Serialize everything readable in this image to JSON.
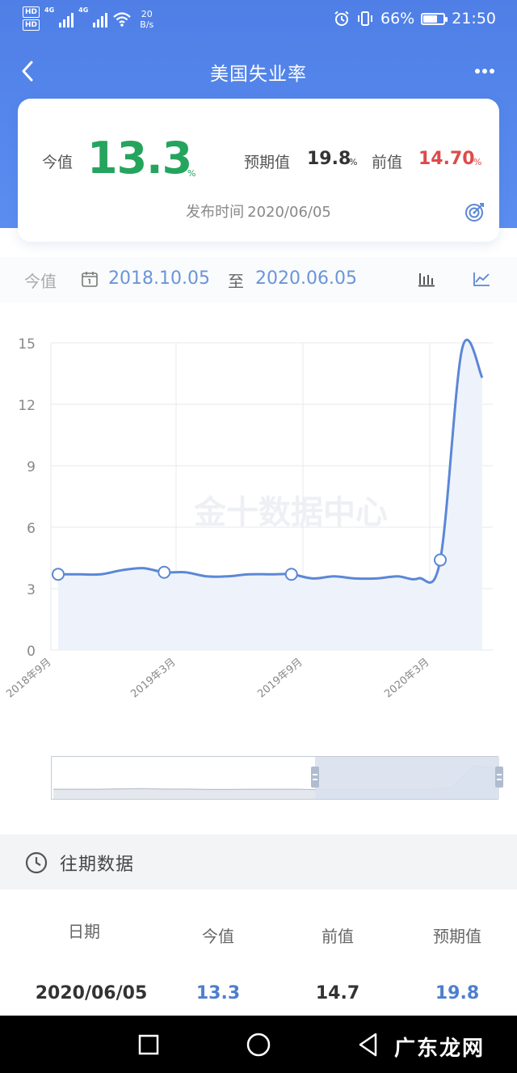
{
  "status_bar": {
    "hd1": "HD",
    "hd2": "HD",
    "net1": "4G",
    "net2": "4G",
    "speed_value": "20",
    "speed_unit": "B/s",
    "battery": "66%",
    "time": "21:50"
  },
  "nav": {
    "title": "美国失业率"
  },
  "summary": {
    "current_label": "今值",
    "current_value": "13.3",
    "current_unit": "%",
    "expected_label": "预期值",
    "expected_value": "19.8",
    "expected_unit": "%",
    "previous_label": "前值",
    "previous_value": "14.70",
    "previous_unit": "%",
    "publish_label": "发布时间",
    "publish_date": "2020/06/05",
    "colors": {
      "current": "#25a45e",
      "previous": "#de4a4a"
    }
  },
  "range": {
    "kind": "今值",
    "start": "2018.10.05",
    "to": "至",
    "end": "2020.06.05"
  },
  "chart_data": {
    "type": "line",
    "title": "",
    "xlabel": "",
    "ylabel": "",
    "watermark": "金十数据中心",
    "x": [
      "2018-10",
      "2018-11",
      "2018-12",
      "2019-01",
      "2019-02",
      "2019-03",
      "2019-04",
      "2019-05",
      "2019-06",
      "2019-07",
      "2019-08",
      "2019-09",
      "2019-10",
      "2019-11",
      "2019-12",
      "2020-01",
      "2020-02",
      "2020-03",
      "2020-04",
      "2020-05"
    ],
    "values": [
      3.7,
      3.7,
      3.7,
      3.9,
      4.0,
      3.8,
      3.8,
      3.6,
      3.6,
      3.7,
      3.7,
      3.7,
      3.5,
      3.6,
      3.5,
      3.5,
      3.6,
      3.5,
      4.4,
      14.7,
      13.3
    ],
    "x_ticks": [
      "2018年9月",
      "2019年3月",
      "2019年9月",
      "2020年3月"
    ],
    "y_ticks": [
      "0",
      "3",
      "6",
      "9",
      "12",
      "15"
    ],
    "ylim": [
      0,
      15
    ],
    "grid": true,
    "line_color": "#5b87d6",
    "area_color": "#eef3fb"
  },
  "history": {
    "title": "往期数据",
    "columns": [
      "日期",
      "今值",
      "前值",
      "预期值"
    ],
    "rows": [
      {
        "date": "2020/06/05",
        "current": "13.3",
        "previous": "14.7",
        "expected": "19.8"
      }
    ]
  },
  "watermark_brand": "广东龙网"
}
